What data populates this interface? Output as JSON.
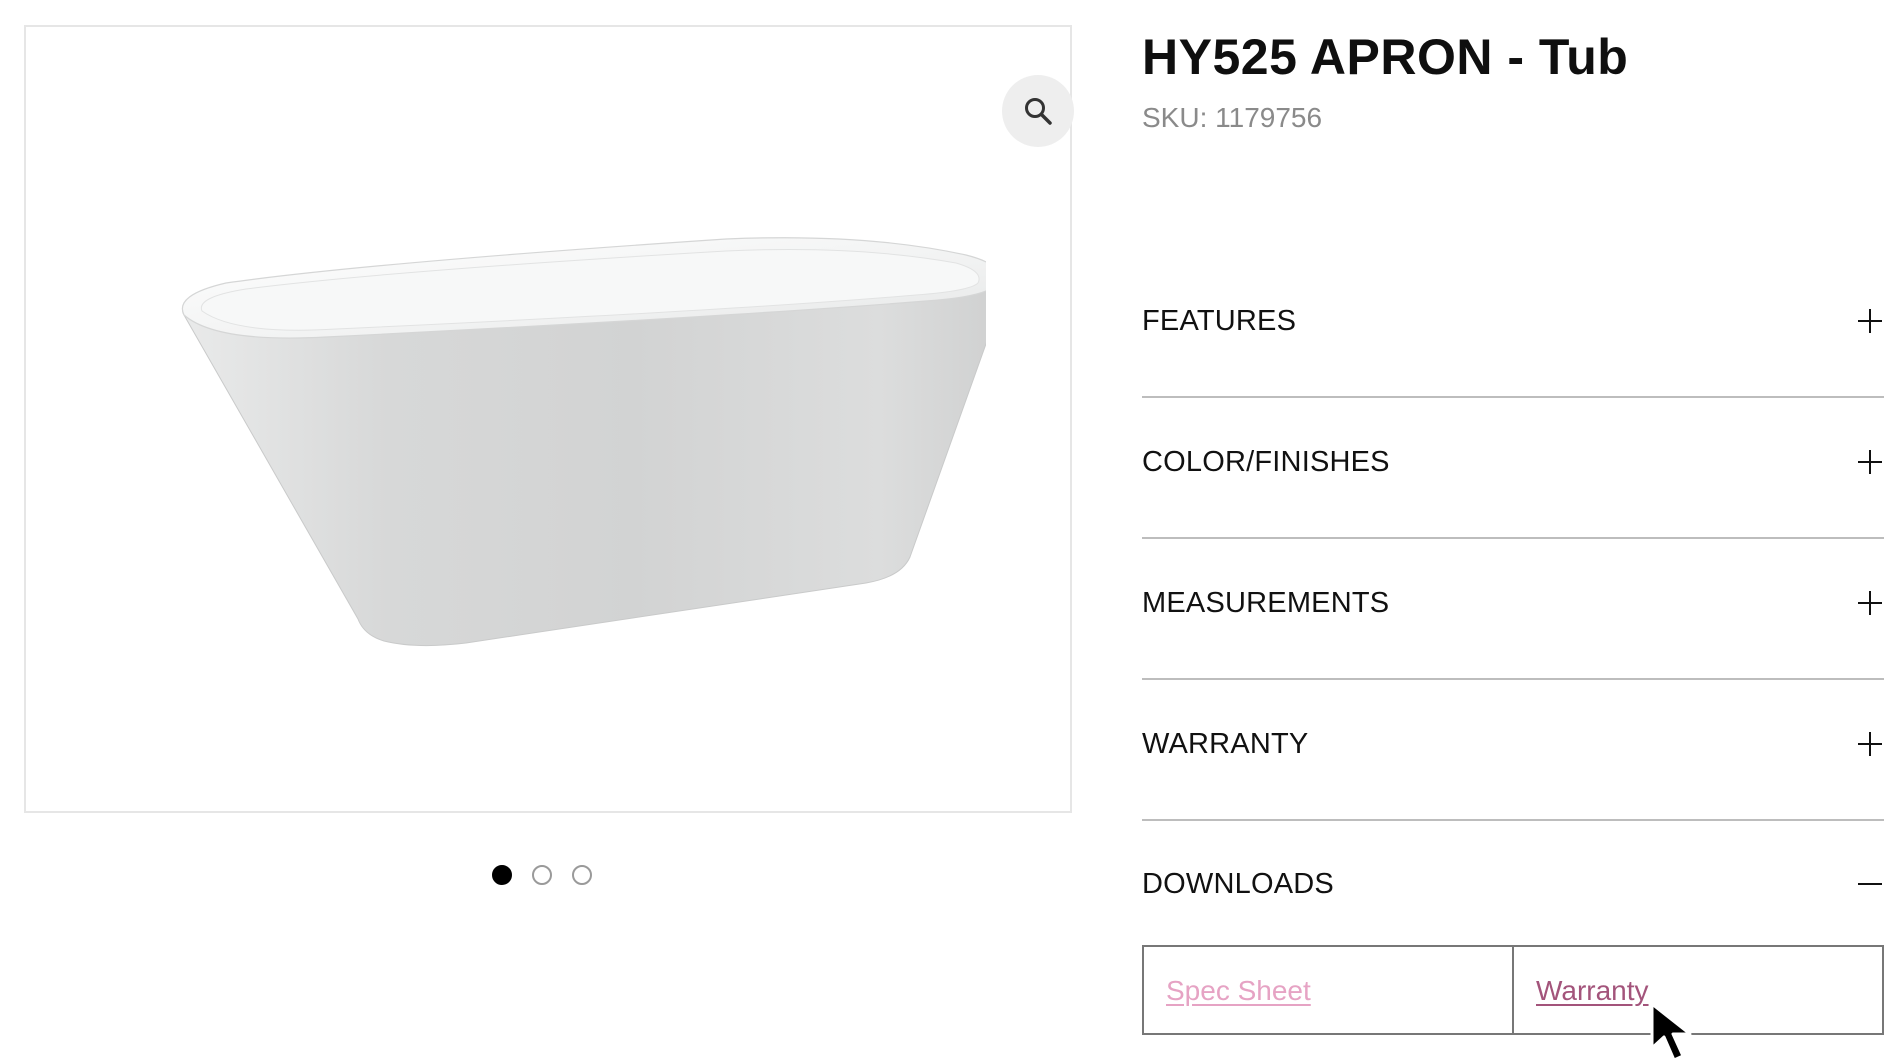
{
  "gallery": {
    "zoom_icon": "magnifier-icon",
    "slide_count": 3,
    "active_slide": 1
  },
  "product": {
    "title": "HY525 APRON - Tub",
    "sku_label": "SKU:",
    "sku_value": "1179756"
  },
  "accordion": {
    "items": [
      {
        "label": "FEATURES",
        "expanded": false
      },
      {
        "label": "COLOR/FINISHES",
        "expanded": false
      },
      {
        "label": "MEASUREMENTS",
        "expanded": false
      },
      {
        "label": "WARRANTY",
        "expanded": false
      },
      {
        "label": "DOWNLOADS",
        "expanded": true
      }
    ]
  },
  "downloads": {
    "links": [
      {
        "label": "Spec Sheet",
        "color": "#e6a3c4"
      },
      {
        "label": "Warranty",
        "color": "#a3547b"
      }
    ]
  },
  "colors": {
    "border_light": "#e6e6e6",
    "divider": "#bdbdbd",
    "zoom_bg": "#eeeeee",
    "link_pink": "#e6a3c4",
    "link_hover": "#a3547b"
  }
}
